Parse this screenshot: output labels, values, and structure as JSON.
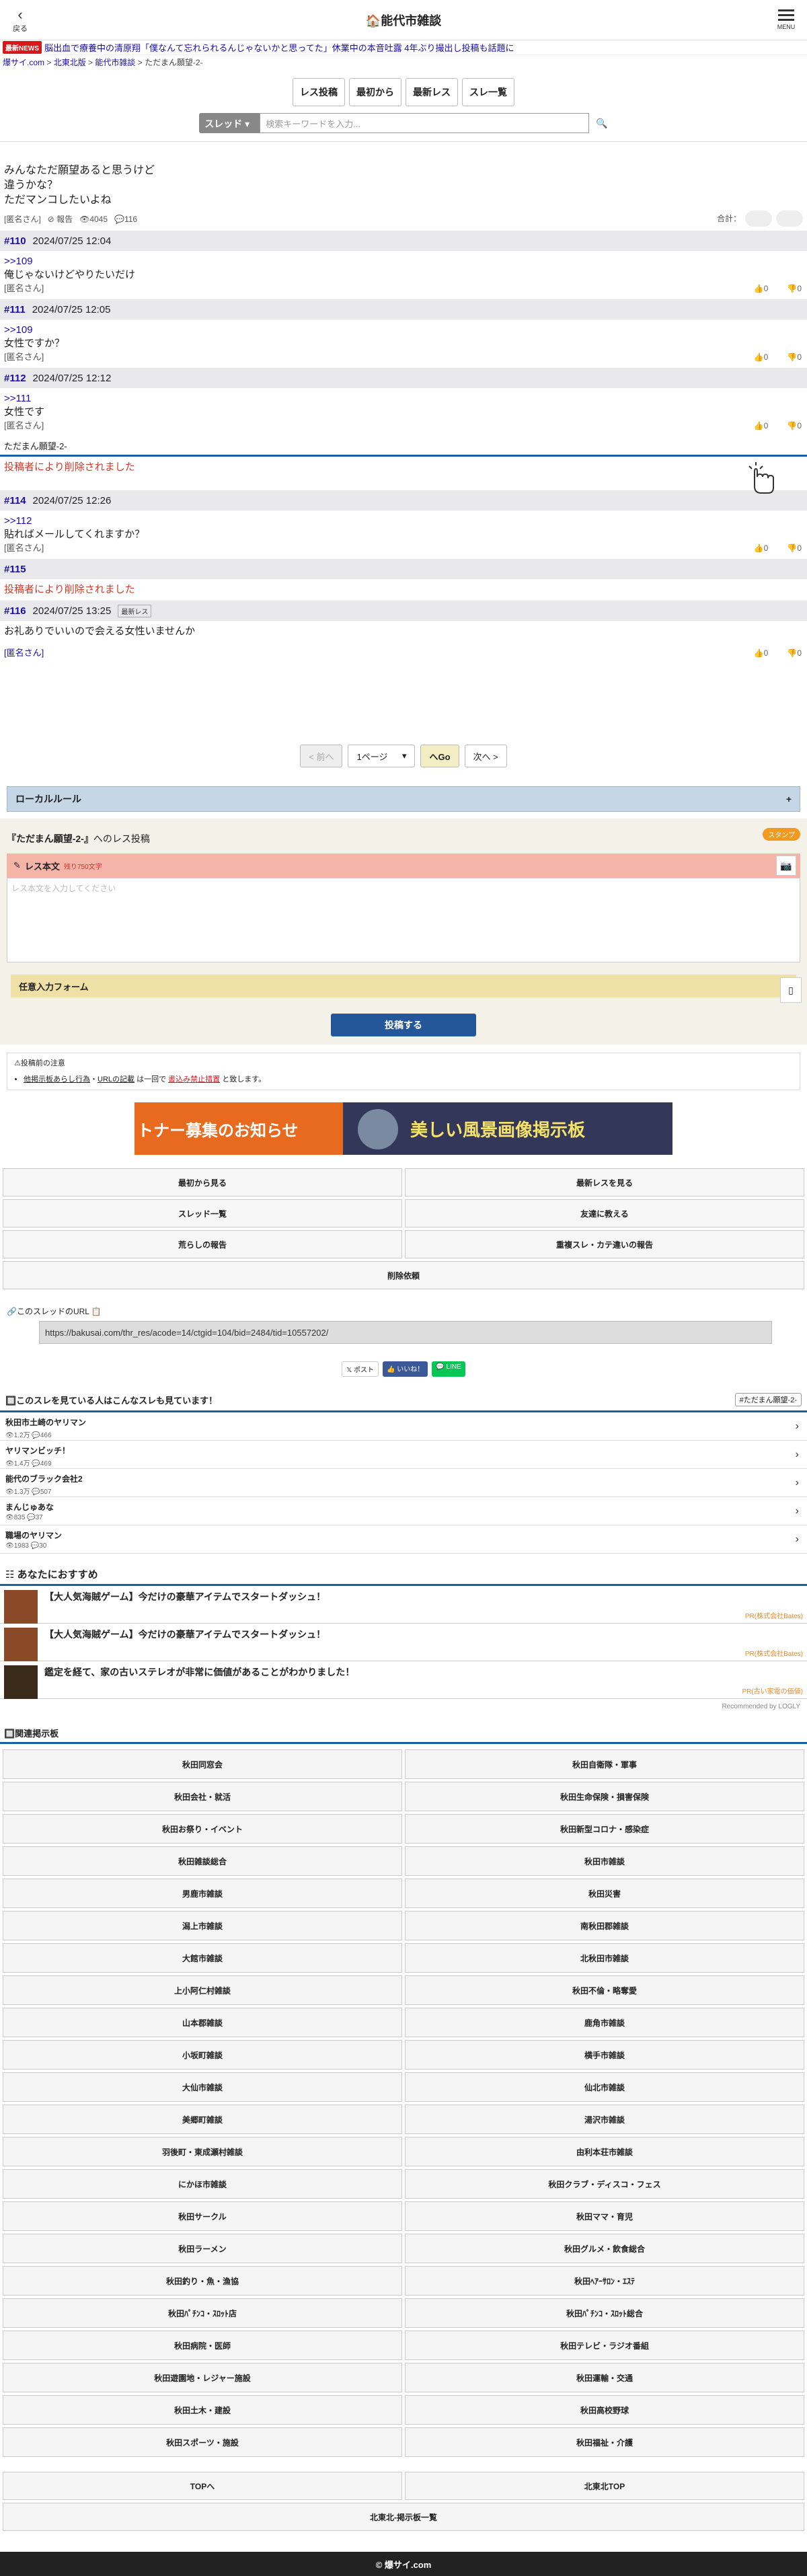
{
  "header": {
    "back_label": "戻る",
    "title": "🏠能代市雑談",
    "menu_label": "MENU"
  },
  "ticker": {
    "badge": "最新NEWS",
    "text": "脳出血で療養中の清原翔「僕なんて忘れられるんじゃないかと思ってた」休業中の本音吐露 4年ぶり撮出し投稿も話題に"
  },
  "breadcrumb": {
    "site": "爆サイ.com",
    "region": "北東北版",
    "board": "能代市雑談",
    "thread": "ただまん願望-2-",
    "sep": " > "
  },
  "toolbar": {
    "post": "レス投稿",
    "first": "最初から",
    "latest": "最新レス",
    "list": "スレ一覧"
  },
  "search": {
    "select": "スレッド",
    "placeholder": "検索キーワードを入力...",
    "icon": "🔍"
  },
  "op": {
    "lines": [
      "みんなただ願望あると思うけど",
      "違うかな？",
      "ただマンコしたいよね"
    ],
    "name": "[匿名さん]",
    "report": "報告",
    "views": "4045",
    "replies": "116",
    "total_label": "合計："
  },
  "posts": [
    {
      "no": "#110",
      "date": "2024/07/25 12:04",
      "anchor": ">>109",
      "text": "俺じゃないけどやりたいだけ",
      "name": "[匿名さん]",
      "up": "0",
      "down": "0"
    },
    {
      "no": "#111",
      "date": "2024/07/25 12:05",
      "anchor": ">>109",
      "text": "女性ですか？",
      "name": "[匿名さん]",
      "up": "0",
      "down": "0"
    },
    {
      "no": "#112",
      "date": "2024/07/25 12:12",
      "anchor": ">>111",
      "text": "女性です",
      "name": "[匿名さん]",
      "up": "0",
      "down": "0"
    }
  ],
  "thread_end_label": "ただまん願望-2-",
  "deleted_text": "投稿者により削除されました",
  "posts2": [
    {
      "no": "#114",
      "date": "2024/07/25 12:26",
      "anchor": ">>112",
      "text": "貼ればメールしてくれますか？",
      "name": "[匿名さん]",
      "up": "0",
      "down": "0"
    }
  ],
  "post115": {
    "no": "#115",
    "text": "投稿者により削除されました"
  },
  "post116": {
    "no": "#116",
    "date": "2024/07/25 13:25",
    "badge": "最新レス",
    "text": "お礼ありでいいので会える女性いませんか",
    "name": "[匿名さん]",
    "up": "0",
    "down": "0"
  },
  "pager": {
    "prev": "< 前へ",
    "page": "1ページ",
    "go": "へGo",
    "next": "次へ >"
  },
  "local_rule": {
    "label": "ローカルルール",
    "toggle": "+"
  },
  "form": {
    "title_quote": "『ただまん願望-2-』",
    "title_suffix": "へのレス投稿",
    "stamp": "スタンプ",
    "body_label": "レス本文",
    "remaining": "残り750文字",
    "placeholder": "レス本文を入力してください",
    "optional": "任意入力フォーム",
    "submit": "投稿する"
  },
  "notice": {
    "title": "⚠投稿前の注意",
    "item_a": "他掲示板あらし行為",
    "item_b": "URLの記載",
    "mid": "は一回で",
    "item_c": "書込み禁止措置",
    "end": "と致します。"
  },
  "banner": {
    "left": "トナー募集のお知らせ",
    "right": "美しい風景画像掲示板"
  },
  "actions": [
    "最初から見る",
    "最新レスを見る",
    "スレッド一覧",
    "友達に教える",
    "荒らしの報告",
    "重複スレ・カテ違いの報告"
  ],
  "delete_request": "削除依頼",
  "url_section": {
    "label": "🔗このスレッドのURL 📋",
    "url": "https://bakusai.com/thr_res/acode=14/ctgid=104/bid=2484/tid=10557202/"
  },
  "share": {
    "x": "𝕏 ポスト",
    "fb": "👍 いいね！",
    "line": "💬 LINE"
  },
  "related": {
    "title": "🔲このスレを見ている人はこんなスレも見ています！",
    "tag": "#ただまん願望-2-",
    "items": [
      {
        "t": "秋田市土崎のヤリマン",
        "s": "👁1.2万 💬466"
      },
      {
        "t": "ヤリマンビッチ！",
        "s": "👁1.4万 💬469"
      },
      {
        "t": "能代のブラック会社2",
        "s": "👁1.3万 💬507"
      },
      {
        "t": "まんじゅあな",
        "s": "👁835 💬37"
      },
      {
        "t": "職場のヤリマン",
        "s": "👁1983 💬30"
      }
    ]
  },
  "recommend": {
    "title": "☷ あなたにおすすめ",
    "items": [
      {
        "t": "【大人気海賊ゲーム】今だけの豪華アイテムでスタートダッシュ！",
        "pr": "PR(株式会社Bates)"
      },
      {
        "t": "【大人気海賊ゲーム】今だけの豪華アイテムでスタートダッシュ！",
        "pr": "PR(株式会社Bates)"
      },
      {
        "t": "鑑定を経て、家の古いステレオが非常に価値があることがわかりました！",
        "pr": "PR(古い家電の価値)"
      }
    ],
    "by": "Recommended by LOGLY"
  },
  "boards": {
    "title": "🔲関連掲示板",
    "items": [
      "秋田同窓会",
      "秋田自衛隊・軍事",
      "秋田会社・就活",
      "秋田生命保険・損害保険",
      "秋田お祭り・イベント",
      "秋田新型コロナ・感染症",
      "秋田雑談総合",
      "秋田市雑談",
      "男鹿市雑談",
      "秋田災害",
      "潟上市雑談",
      "南秋田郡雑談",
      "大館市雑談",
      "北秋田市雑談",
      "上小阿仁村雑談",
      "秋田不倫・略奪愛",
      "山本郡雑談",
      "鹿角市雑談",
      "小坂町雑談",
      "横手市雑談",
      "大仙市雑談",
      "仙北市雑談",
      "美郷町雑談",
      "湯沢市雑談",
      "羽後町・東成瀬村雑談",
      "由利本荘市雑談",
      "にかほ市雑談",
      "秋田クラブ・ディスコ・フェス",
      "秋田サークル",
      "秋田ママ・育児",
      "秋田ラーメン",
      "秋田グルメ・飲食総合",
      "秋田釣り・魚・漁協",
      "秋田ﾍｱｰｻﾛﾝ・ｴｽﾃ",
      "秋田ﾊﾟﾁﾝｺ・ｽﾛｯﾄ店",
      "秋田ﾊﾟﾁﾝｺ・ｽﾛｯﾄ総合",
      "秋田病院・医師",
      "秋田テレビ・ラジオ番組",
      "秋田遊園地・レジャー施設",
      "秋田運輸・交通",
      "秋田土木・建設",
      "秋田高校野球",
      "秋田スポーツ・施設",
      "秋田福祉・介護"
    ]
  },
  "bottom": {
    "top": "TOPへ",
    "region_top": "北東北TOP",
    "list": "北東北-掲示板一覧"
  },
  "footer": "© 爆サイ.com"
}
